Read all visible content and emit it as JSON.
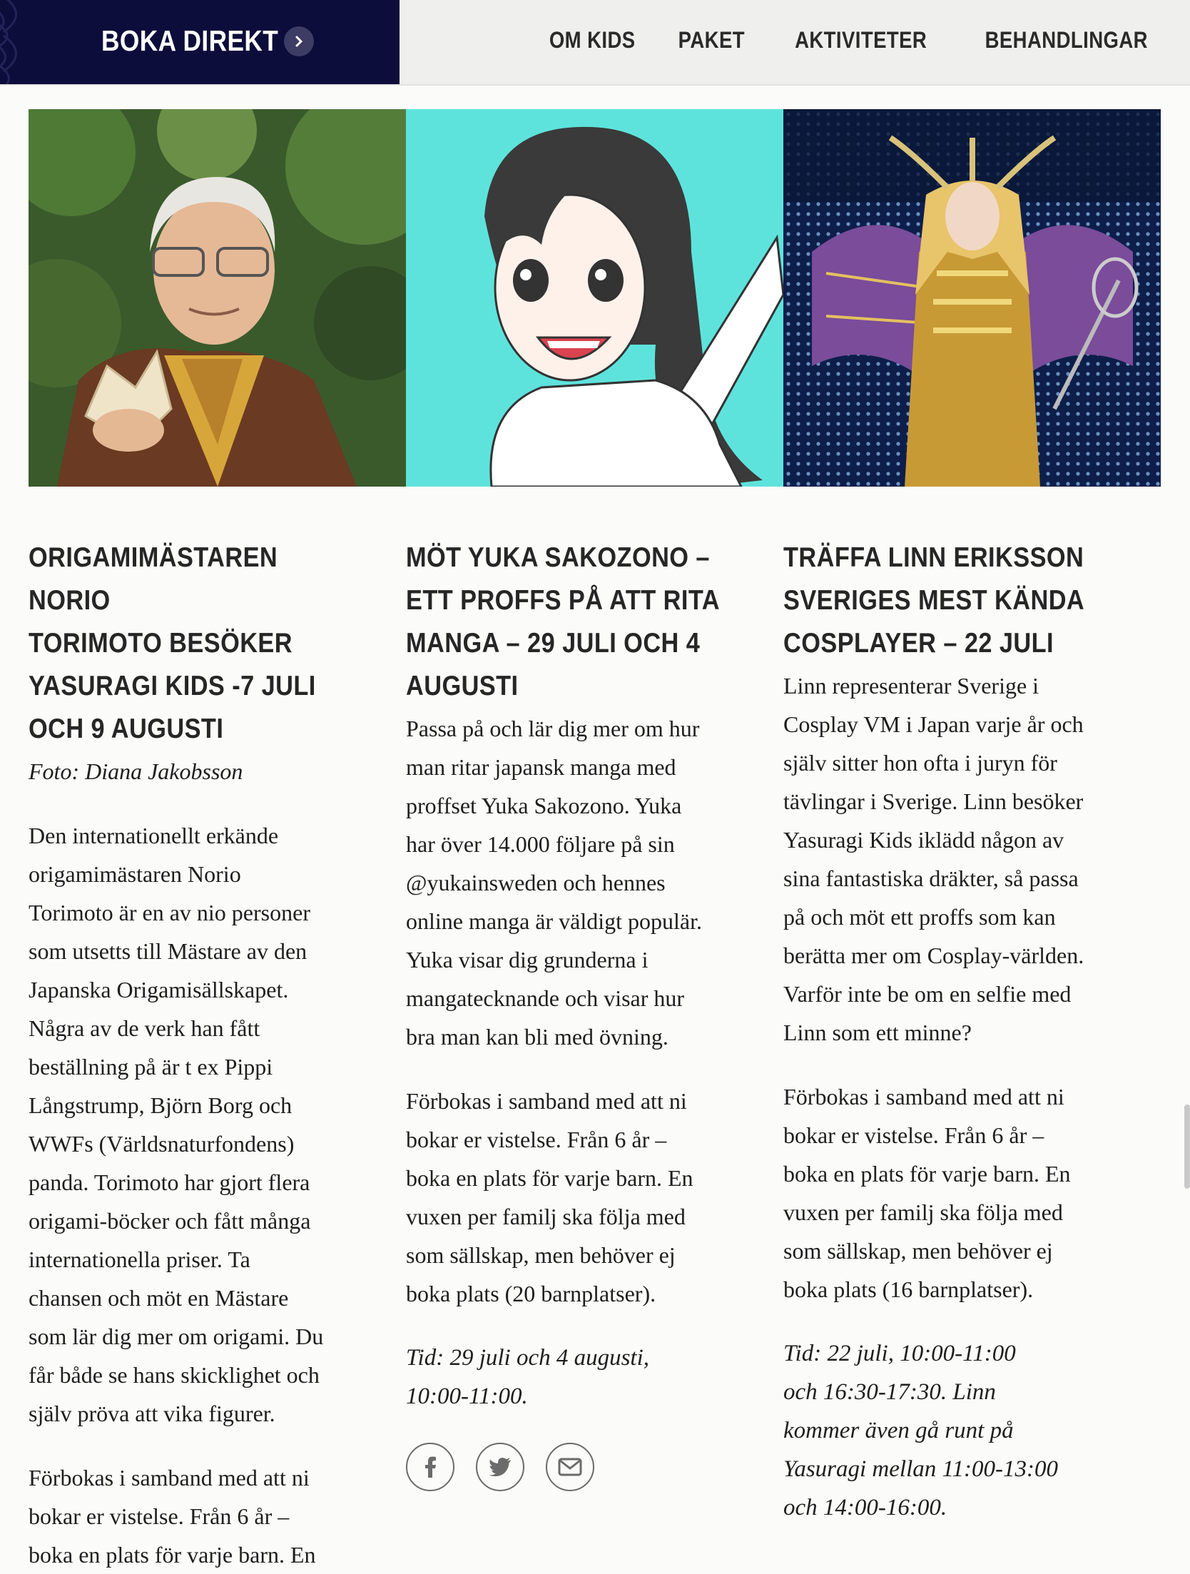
{
  "header": {
    "book_label": "BOKA DIREKT",
    "book_arrow_icon": "chevron-right-icon",
    "nav": [
      "OM KIDS",
      "PAKET",
      "AKTIVITETER",
      "BEHANDLINGAR"
    ]
  },
  "colors": {
    "header_dark": "#0d0d3b",
    "header_bg": "#efefee",
    "manga_bg": "#5ee3dc"
  },
  "articles": [
    {
      "title_lines": [
        "ORIGAMIMÄSTAREN NORIO",
        "TORIMOTO BESÖKER",
        "YASURAGI KIDS -7 JULI",
        "OCH 9 AUGUSTI"
      ],
      "caption": "Foto: Diana Jakobsson",
      "body1_lines": [
        "Den internationellt erkände",
        "origamimästaren Norio",
        "Torimoto är en av nio personer",
        "som utsetts till Mästare av den",
        "Japanska Origamisällskapet.",
        "Några av de verk han fått",
        "beställning på är t ex Pippi",
        "Långstrump, Björn Borg och",
        "WWFs (Världsnaturfondens)",
        "panda. Torimoto har gjort flera",
        "origami-böcker och fått många",
        "internationella priser. Ta",
        "chansen och möt en Mästare",
        "som lär dig mer om origami. Du",
        "får både se hans skicklighet och",
        "själv pröva att vika figurer."
      ],
      "body2_lines": [
        "Förbokas i samband med att ni",
        "bokar er vistelse. Från 6 år –",
        "boka en plats för varje barn. En"
      ]
    },
    {
      "title_lines": [
        "MÖT YUKA SAKOZONO –",
        "ETT PROFFS PÅ ATT RITA",
        "MANGA – 29 JULI OCH 4",
        "AUGUSTI"
      ],
      "body1_lines": [
        "Passa på och lär dig mer om hur",
        "man ritar japansk manga med",
        "proffset Yuka Sakozono. Yuka",
        "har över 14.000 följare på sin",
        "@yukainsweden och hennes",
        "online manga är väldigt populär.",
        "Yuka visar dig grunderna i",
        "mangatecknande och visar hur",
        "bra man kan bli med övning."
      ],
      "body2_lines": [
        "Förbokas i samband med att ni",
        "bokar er vistelse. Från 6 år –",
        "boka en plats för varje barn. En",
        "vuxen per familj ska följa med",
        "som sällskap, men behöver ej",
        "boka plats (20 barnplatser)."
      ],
      "time_lines": [
        "Tid: 29 juli och 4 augusti,",
        "10:00-11:00."
      ],
      "share_icons": [
        "facebook-icon",
        "twitter-icon",
        "email-icon"
      ]
    },
    {
      "title_lines": [
        "TRÄFFA LINN ERIKSSON",
        "SVERIGES MEST KÄNDA",
        "COSPLAYER – 22 JULI"
      ],
      "body1_lines": [
        "Linn representerar Sverige i",
        "Cosplay VM i Japan varje år och",
        "själv sitter hon ofta i juryn för",
        "tävlingar i Sverige. Linn besöker",
        "Yasuragi Kids iklädd någon av",
        "sina fantastiska dräkter, så passa",
        "på och möt ett proffs som kan",
        "berätta mer om Cosplay-världen.",
        "Varför inte be om en selfie med",
        "Linn som ett minne?"
      ],
      "body2_lines": [
        "Förbokas i samband med att ni",
        "bokar er vistelse. Från 6 år –",
        "boka en plats för varje barn. En",
        "vuxen per familj ska följa med",
        "som sällskap, men behöver ej",
        "boka plats (16 barnplatser)."
      ],
      "time_lines": [
        "Tid: 22 juli, 10:00-11:00",
        "och 16:30-17:30. Linn",
        "kommer även gå runt på",
        "Yasuragi mellan 11:00-13:00",
        "och 14:00-16:00."
      ]
    }
  ]
}
